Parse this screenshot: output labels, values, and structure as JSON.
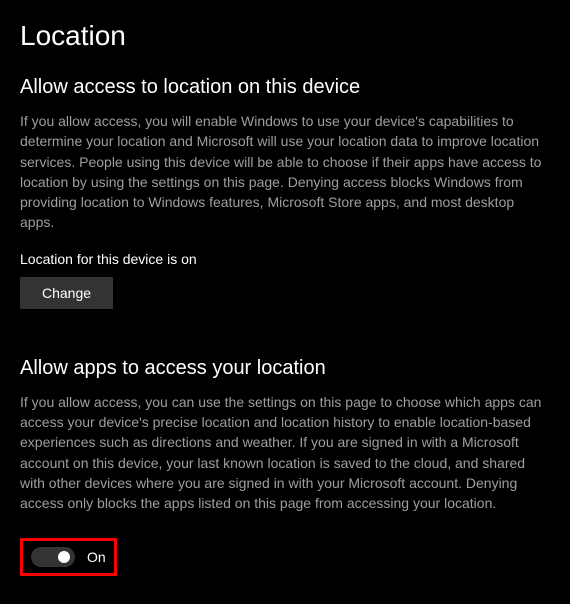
{
  "page": {
    "title": "Location"
  },
  "section1": {
    "heading": "Allow access to location on this device",
    "body": "If you allow access, you will enable Windows to use your device's capabilities to determine your location and Microsoft will use your location data to improve location services. People using this device will be able to choose if their apps have access to location by using the settings on this page. Denying access blocks Windows from providing location to Windows features, Microsoft Store apps, and most desktop apps.",
    "status": "Location for this device is on",
    "change_button_label": "Change"
  },
  "section2": {
    "heading": "Allow apps to access your location",
    "body": "If you allow access, you can use the settings on this page to choose which apps can access your device's precise location and location history to enable location-based experiences such as directions and weather. If you are signed in with a Microsoft account on this device, your last known location is saved to the cloud, and shared with other devices where you are signed in with your Microsoft account. Denying access only blocks the apps listed on this page from accessing your location.",
    "toggle_state": "On"
  }
}
